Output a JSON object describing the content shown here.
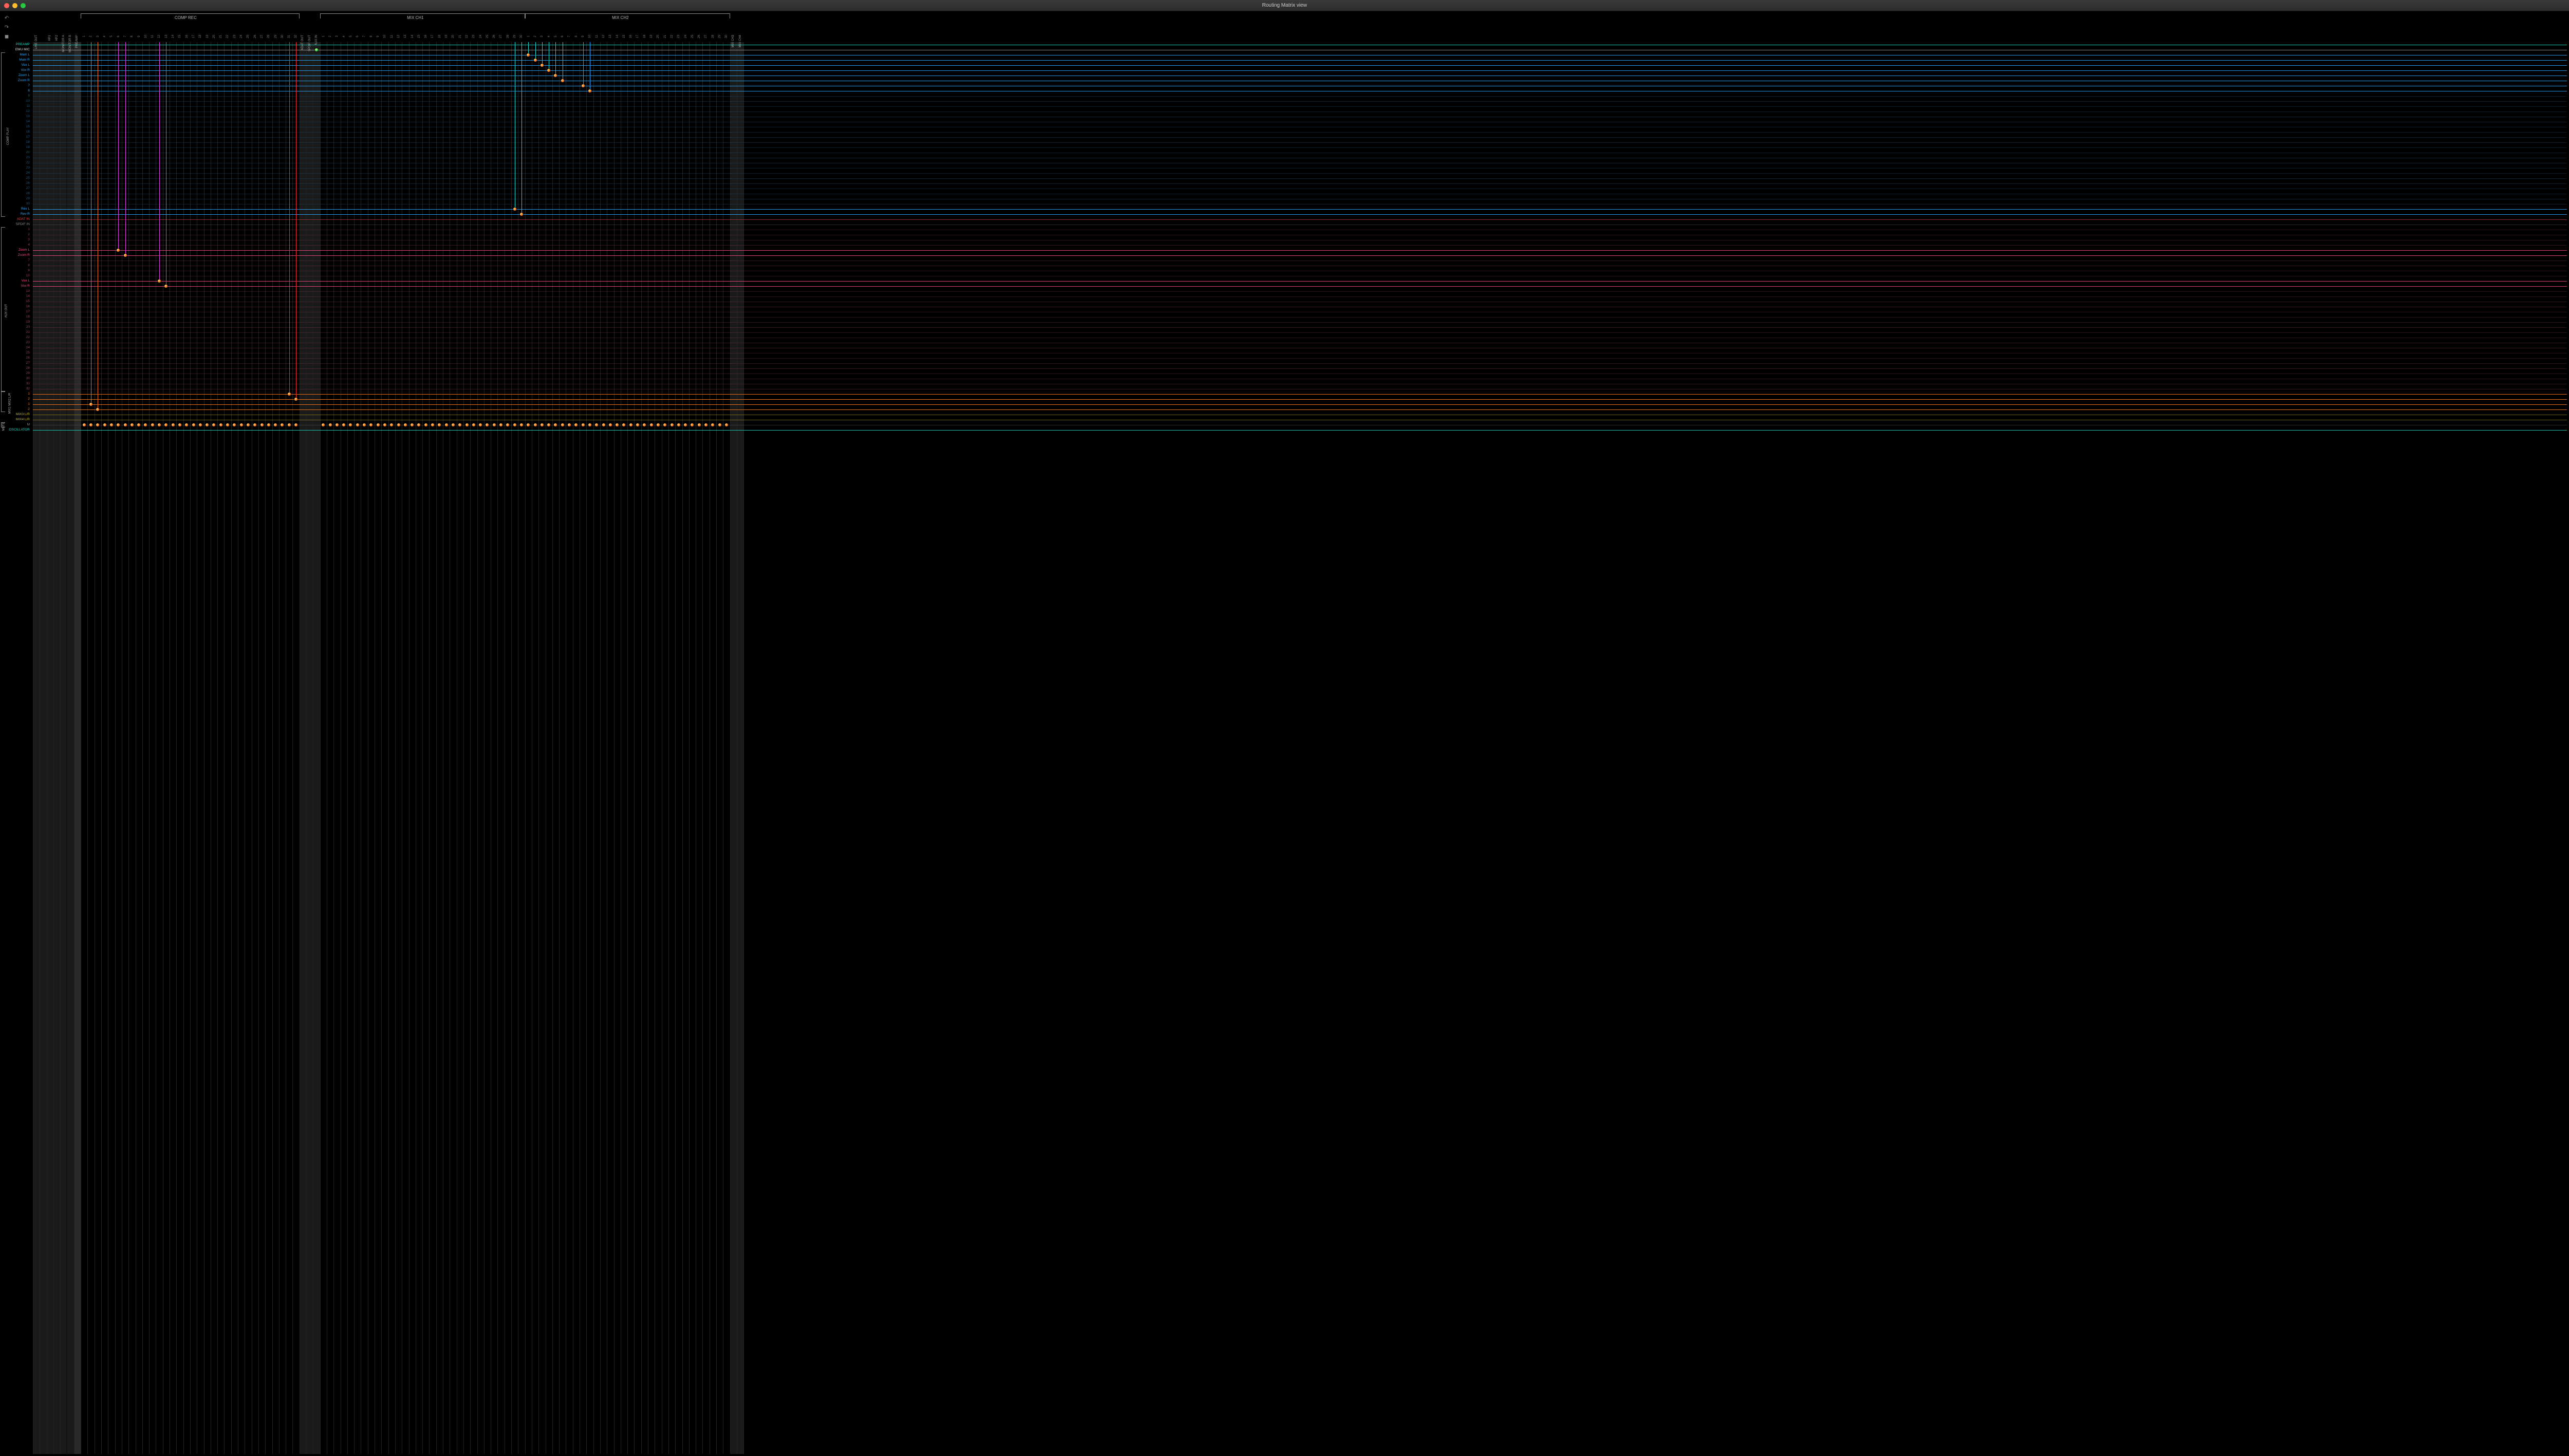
{
  "window": {
    "title": "Routing Matrix view"
  },
  "colGroups": [
    {
      "label": "LINE OUT",
      "vert": true,
      "start": 0,
      "span": 2,
      "band": "heavy"
    },
    {
      "label": "HP1",
      "vert": true,
      "start": 2,
      "span": 1,
      "band": "heavy"
    },
    {
      "label": "HP2",
      "vert": true,
      "start": 3,
      "span": 1,
      "band": "heavy"
    },
    {
      "label": "MONITOR A",
      "vert": true,
      "start": 4,
      "span": 1,
      "band": "heavy"
    },
    {
      "label": "MONITOR B",
      "vert": true,
      "start": 5,
      "span": 1,
      "band": "heavy"
    },
    {
      "label": "PREAMP",
      "vert": true,
      "start": 6,
      "span": 1,
      "band": "vheavy"
    },
    {
      "label": "COMP REC",
      "vert": false,
      "start": 7,
      "span": 32,
      "bracket": true
    },
    {
      "label": "ADAT OUT",
      "vert": true,
      "start": 39,
      "span": 1,
      "band": "heavy"
    },
    {
      "label": "SPDIF OUT",
      "vert": true,
      "start": 40,
      "span": 1,
      "band": "heavy"
    },
    {
      "label": "AUX IN",
      "vert": true,
      "start": 41,
      "span": 1,
      "band": "heavy"
    },
    {
      "label": "MIX CH1",
      "vert": false,
      "start": 42,
      "span": 30,
      "bracket": true
    },
    {
      "label": "MIX CH2",
      "vert": false,
      "start": 72,
      "span": 30,
      "bracket": true
    },
    {
      "label": "MIX CH3",
      "vert": true,
      "start": 102,
      "span": 1,
      "band": "heavy"
    },
    {
      "label": "MIX CH4",
      "vert": true,
      "start": 103,
      "span": 1,
      "band": "heavy"
    }
  ],
  "rowGroups": [
    {
      "label": "",
      "rows": [
        {
          "label": "PREAMP",
          "color": "teal-b",
          "bright": true
        },
        {
          "label": "EMU MIC",
          "color": "white",
          "bright": true
        }
      ]
    },
    {
      "label": "COMP PLAY",
      "rows": [
        {
          "label": "Main L",
          "color": "cyan-b"
        },
        {
          "label": "Main R",
          "color": "cyan-b"
        },
        {
          "label": "Vox L",
          "color": "cyan-b"
        },
        {
          "label": "Vox R",
          "color": "cyan-b"
        },
        {
          "label": "Zoom L",
          "color": "cyan-b"
        },
        {
          "label": "Zoom R",
          "color": "cyan-b"
        },
        {
          "label": "7",
          "color": "cyan-b"
        },
        {
          "label": "8",
          "color": "cyan-b"
        },
        {
          "label": "9",
          "color": "cyan"
        },
        {
          "label": "10",
          "color": "cyan"
        },
        {
          "label": "11",
          "color": "cyan"
        },
        {
          "label": "12",
          "color": "cyan"
        },
        {
          "label": "13",
          "color": "cyan"
        },
        {
          "label": "14",
          "color": "cyan"
        },
        {
          "label": "15",
          "color": "cyan"
        },
        {
          "label": "16",
          "color": "cyan"
        },
        {
          "label": "17",
          "color": "cyan"
        },
        {
          "label": "18",
          "color": "cyan"
        },
        {
          "label": "19",
          "color": "cyan"
        },
        {
          "label": "20",
          "color": "cyan"
        },
        {
          "label": "21",
          "color": "cyan"
        },
        {
          "label": "22",
          "color": "cyan"
        },
        {
          "label": "23",
          "color": "cyan"
        },
        {
          "label": "24",
          "color": "cyan"
        },
        {
          "label": "25",
          "color": "cyan"
        },
        {
          "label": "26",
          "color": "cyan"
        },
        {
          "label": "27",
          "color": "cyan"
        },
        {
          "label": "28",
          "color": "cyan"
        },
        {
          "label": "29",
          "color": "cyan"
        },
        {
          "label": "30",
          "color": "cyan"
        },
        {
          "label": "Rev L",
          "color": "cyan-b"
        },
        {
          "label": "Rev R",
          "color": "cyan-b"
        }
      ]
    },
    {
      "label": "",
      "rows": [
        {
          "label": "ADAT IN",
          "color": "red"
        },
        {
          "label": "SPDIF IN",
          "color": "grey"
        }
      ]
    },
    {
      "label": "AUX OUT",
      "rows": [
        {
          "label": "1",
          "color": "pink"
        },
        {
          "label": "2",
          "color": "pink"
        },
        {
          "label": "3",
          "color": "pink"
        },
        {
          "label": "4",
          "color": "pink"
        },
        {
          "label": "Zoom L",
          "color": "pink-b"
        },
        {
          "label": "Zoom R",
          "color": "pink-b"
        },
        {
          "label": "7",
          "color": "pink"
        },
        {
          "label": "8",
          "color": "pink"
        },
        {
          "label": "9",
          "color": "pink"
        },
        {
          "label": "10",
          "color": "pink"
        },
        {
          "label": "Vox L",
          "color": "pink-b"
        },
        {
          "label": "Vox R",
          "color": "pink-b"
        },
        {
          "label": "13",
          "color": "pink"
        },
        {
          "label": "14",
          "color": "pink"
        },
        {
          "label": "15",
          "color": "pink"
        },
        {
          "label": "16",
          "color": "pink"
        },
        {
          "label": "17",
          "color": "pink"
        },
        {
          "label": "18",
          "color": "pink"
        },
        {
          "label": "19",
          "color": "pink"
        },
        {
          "label": "20",
          "color": "pink"
        },
        {
          "label": "21",
          "color": "pink"
        },
        {
          "label": "22",
          "color": "pink"
        },
        {
          "label": "23",
          "color": "pink"
        },
        {
          "label": "24",
          "color": "pink"
        },
        {
          "label": "25",
          "color": "pink"
        },
        {
          "label": "26",
          "color": "pink"
        },
        {
          "label": "27",
          "color": "pink"
        },
        {
          "label": "28",
          "color": "pink"
        },
        {
          "label": "29",
          "color": "pink"
        },
        {
          "label": "30",
          "color": "pink"
        },
        {
          "label": "31",
          "color": "pink"
        },
        {
          "label": "32",
          "color": "pink"
        }
      ]
    },
    {
      "label": "MIX1  MIX2 L/R",
      "rows": [
        {
          "label": "1",
          "color": "orange-b"
        },
        {
          "label": "2",
          "color": "orange-b"
        },
        {
          "label": "1",
          "color": "orange-b"
        },
        {
          "label": "2",
          "color": "orange-b"
        }
      ]
    },
    {
      "label": "",
      "rows": [
        {
          "label": "MIX3 L/R",
          "color": "yellow"
        },
        {
          "label": "MIX4 L/R",
          "color": "yellow"
        }
      ]
    },
    {
      "label": "MUTE",
      "rows": [
        {
          "label": "M",
          "color": "grey"
        }
      ]
    },
    {
      "label": "",
      "rows": [
        {
          "label": "OSCILLATOR",
          "color": "teal-b"
        }
      ]
    }
  ],
  "nodes": [
    {
      "row": 1,
      "col": 41,
      "kind": "green"
    },
    {
      "row": 2,
      "col": 72
    },
    {
      "row": 3,
      "col": 73
    },
    {
      "row": 4,
      "col": 74
    },
    {
      "row": 5,
      "col": 75
    },
    {
      "row": 6,
      "col": 76
    },
    {
      "row": 7,
      "col": 77
    },
    {
      "row": 8,
      "col": 80
    },
    {
      "row": 9,
      "col": 81
    },
    {
      "row": 32,
      "col": 70
    },
    {
      "row": 33,
      "col": 71
    },
    {
      "row": 40,
      "col": 12
    },
    {
      "row": 41,
      "col": 13
    },
    {
      "row": 46,
      "col": 18
    },
    {
      "row": 47,
      "col": 19
    },
    {
      "row": 68,
      "col": 37
    },
    {
      "row": 69,
      "col": 38
    },
    {
      "row": 70,
      "col": 8
    },
    {
      "row": 71,
      "col": 9
    },
    {
      "row": 74,
      "col": 7
    },
    {
      "row": 74,
      "col": 8
    },
    {
      "row": 74,
      "col": 9
    },
    {
      "row": 74,
      "col": 10
    },
    {
      "row": 74,
      "col": 11
    },
    {
      "row": 74,
      "col": 12
    },
    {
      "row": 74,
      "col": 13
    },
    {
      "row": 74,
      "col": 14
    },
    {
      "row": 74,
      "col": 15
    },
    {
      "row": 74,
      "col": 16
    },
    {
      "row": 74,
      "col": 17
    },
    {
      "row": 74,
      "col": 18
    },
    {
      "row": 74,
      "col": 19
    },
    {
      "row": 74,
      "col": 20
    },
    {
      "row": 74,
      "col": 21
    },
    {
      "row": 74,
      "col": 22
    },
    {
      "row": 74,
      "col": 23
    },
    {
      "row": 74,
      "col": 24
    },
    {
      "row": 74,
      "col": 25
    },
    {
      "row": 74,
      "col": 26
    },
    {
      "row": 74,
      "col": 27
    },
    {
      "row": 74,
      "col": 28
    },
    {
      "row": 74,
      "col": 29
    },
    {
      "row": 74,
      "col": 30
    },
    {
      "row": 74,
      "col": 31
    },
    {
      "row": 74,
      "col": 32
    },
    {
      "row": 74,
      "col": 33
    },
    {
      "row": 74,
      "col": 34
    },
    {
      "row": 74,
      "col": 35
    },
    {
      "row": 74,
      "col": 36
    },
    {
      "row": 74,
      "col": 37
    },
    {
      "row": 74,
      "col": 38
    },
    {
      "row": 74,
      "col": 42
    },
    {
      "row": 74,
      "col": 43
    },
    {
      "row": 74,
      "col": 44
    },
    {
      "row": 74,
      "col": 45
    },
    {
      "row": 74,
      "col": 46
    },
    {
      "row": 74,
      "col": 47
    },
    {
      "row": 74,
      "col": 48
    },
    {
      "row": 74,
      "col": 49
    },
    {
      "row": 74,
      "col": 50
    },
    {
      "row": 74,
      "col": 51
    },
    {
      "row": 74,
      "col": 52
    },
    {
      "row": 74,
      "col": 53
    },
    {
      "row": 74,
      "col": 54
    },
    {
      "row": 74,
      "col": 55
    },
    {
      "row": 74,
      "col": 56
    },
    {
      "row": 74,
      "col": 57
    },
    {
      "row": 74,
      "col": 58
    },
    {
      "row": 74,
      "col": 59
    },
    {
      "row": 74,
      "col": 60
    },
    {
      "row": 74,
      "col": 61
    },
    {
      "row": 74,
      "col": 62
    },
    {
      "row": 74,
      "col": 63
    },
    {
      "row": 74,
      "col": 64
    },
    {
      "row": 74,
      "col": 65
    },
    {
      "row": 74,
      "col": 66
    },
    {
      "row": 74,
      "col": 67
    },
    {
      "row": 74,
      "col": 68
    },
    {
      "row": 74,
      "col": 69
    },
    {
      "row": 74,
      "col": 70
    },
    {
      "row": 74,
      "col": 71
    },
    {
      "row": 74,
      "col": 72
    },
    {
      "row": 74,
      "col": 73
    },
    {
      "row": 74,
      "col": 74
    },
    {
      "row": 74,
      "col": 75
    },
    {
      "row": 74,
      "col": 76
    },
    {
      "row": 74,
      "col": 77
    },
    {
      "row": 74,
      "col": 78
    },
    {
      "row": 74,
      "col": 79
    },
    {
      "row": 74,
      "col": 80
    },
    {
      "row": 74,
      "col": 81
    },
    {
      "row": 74,
      "col": 82
    },
    {
      "row": 74,
      "col": 83
    },
    {
      "row": 74,
      "col": 84
    },
    {
      "row": 74,
      "col": 85
    },
    {
      "row": 74,
      "col": 86
    },
    {
      "row": 74,
      "col": 87
    },
    {
      "row": 74,
      "col": 88
    },
    {
      "row": 74,
      "col": 89
    },
    {
      "row": 74,
      "col": 90
    },
    {
      "row": 74,
      "col": 91
    },
    {
      "row": 74,
      "col": 92
    },
    {
      "row": 74,
      "col": 93
    },
    {
      "row": 74,
      "col": 94
    },
    {
      "row": 74,
      "col": 95
    },
    {
      "row": 74,
      "col": 96
    },
    {
      "row": 74,
      "col": 97
    },
    {
      "row": 74,
      "col": 98
    },
    {
      "row": 74,
      "col": 99
    },
    {
      "row": 74,
      "col": 100
    },
    {
      "row": 74,
      "col": 101
    }
  ],
  "vlines": [
    {
      "col": 8,
      "fromRow": 0,
      "toRow": 70,
      "cls": "vl-orange"
    },
    {
      "col": 9,
      "fromRow": 0,
      "toRow": 71,
      "cls": "vl-orange"
    },
    {
      "col": 12,
      "fromRow": 0,
      "toRow": 40,
      "cls": "vl-magenta"
    },
    {
      "col": 13,
      "fromRow": 0,
      "toRow": 41,
      "cls": "vl-magenta"
    },
    {
      "col": 18,
      "fromRow": 0,
      "toRow": 46,
      "cls": "vl-magenta"
    },
    {
      "col": 19,
      "fromRow": 0,
      "toRow": 47,
      "cls": "vl-magenta"
    },
    {
      "col": 37,
      "fromRow": 0,
      "toRow": 68,
      "cls": "vl-red"
    },
    {
      "col": 38,
      "fromRow": 0,
      "toRow": 69,
      "cls": "vl-red"
    },
    {
      "col": 70,
      "fromRow": 0,
      "toRow": 32,
      "cls": "vl-cyanB"
    },
    {
      "col": 71,
      "fromRow": 0,
      "toRow": 33,
      "cls": "vl-cyanB"
    },
    {
      "col": 72,
      "fromRow": 0,
      "toRow": 2,
      "cls": "vl-cyanB"
    },
    {
      "col": 73,
      "fromRow": 0,
      "toRow": 3,
      "cls": "vl-cyanB"
    },
    {
      "col": 74,
      "fromRow": 0,
      "toRow": 4,
      "cls": "vl-cyanB"
    },
    {
      "col": 75,
      "fromRow": 0,
      "toRow": 5,
      "cls": "vl-cyanB"
    },
    {
      "col": 76,
      "fromRow": 0,
      "toRow": 6,
      "cls": "vl-cyanB"
    },
    {
      "col": 77,
      "fromRow": 0,
      "toRow": 7,
      "cls": "vl-cyanB"
    },
    {
      "col": 80,
      "fromRow": 0,
      "toRow": 8,
      "cls": "vl-cyan"
    },
    {
      "col": 81,
      "fromRow": 0,
      "toRow": 9,
      "cls": "vl-cyan"
    }
  ]
}
